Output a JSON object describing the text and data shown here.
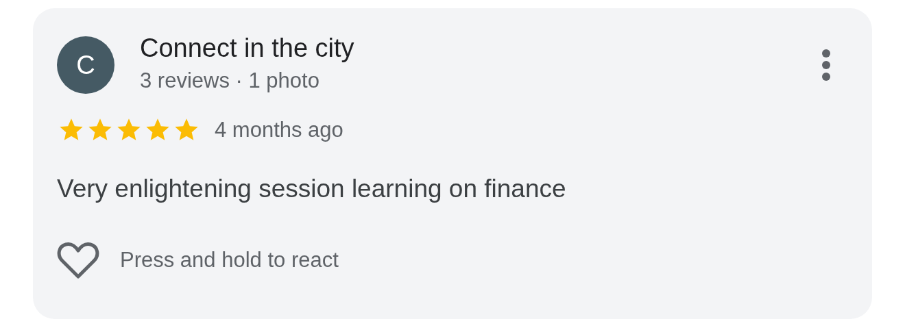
{
  "review": {
    "avatar_letter": "C",
    "author": "Connect in the city",
    "meta": "3 reviews · 1 photo",
    "stars": 5,
    "time": "4 months ago",
    "text": "Very enlightening session learning on finance",
    "reaction_hint": "Press and hold to react"
  }
}
